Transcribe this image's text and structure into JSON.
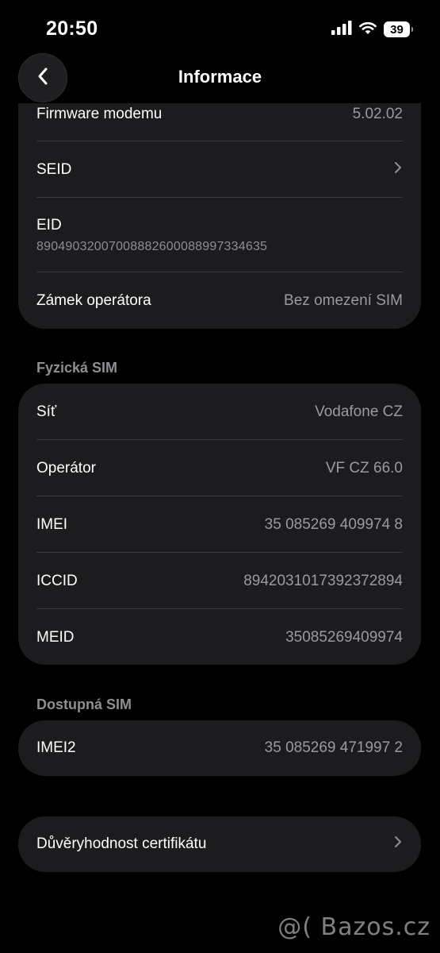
{
  "status_bar": {
    "time": "20:50",
    "battery": "39",
    "icons": [
      "cellular-signal-icon",
      "wifi-icon",
      "battery-icon"
    ]
  },
  "nav": {
    "title": "Informace",
    "back_icon": "chevron-left-icon"
  },
  "top_card": {
    "firmware": {
      "label": "Firmware modemu",
      "value": "5.02.02"
    },
    "seid": {
      "label": "SEID"
    },
    "eid": {
      "label": "EID",
      "value": "89049032007008882600088997334635"
    },
    "carrier_lock": {
      "label": "Zámek operátora",
      "value": "Bez omezení SIM"
    }
  },
  "physical_sim": {
    "header": "Fyzická SIM",
    "rows": [
      {
        "label": "Síť",
        "value": "Vodafone CZ"
      },
      {
        "label": "Operátor",
        "value": "VF CZ 66.0"
      },
      {
        "label": "IMEI",
        "value": "35 085269 409974 8"
      },
      {
        "label": "ICCID",
        "value": "8942031017392372894"
      },
      {
        "label": "MEID",
        "value": "35085269409974"
      }
    ]
  },
  "available_sim": {
    "header": "Dostupná SIM",
    "rows": [
      {
        "label": "IMEI2",
        "value": "35 085269 471997 2"
      }
    ]
  },
  "certificate_trust": {
    "label": "Důvěryhodnost certifikátu"
  },
  "watermark": "@( Bazos.cz",
  "colors": {
    "background": "#000000",
    "card": "#1c1c1e",
    "secondary_text": "#9a9a9f",
    "separator": "#38383a"
  }
}
